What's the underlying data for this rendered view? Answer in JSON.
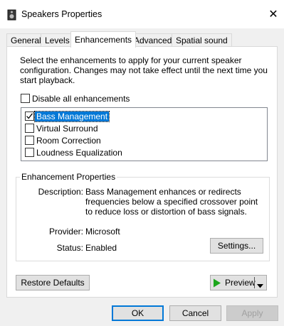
{
  "window": {
    "title": "Speakers Properties",
    "close_icon": "close-icon"
  },
  "tabs": [
    {
      "label": "General",
      "active": false
    },
    {
      "label": "Levels",
      "active": false
    },
    {
      "label": "Enhancements",
      "active": true
    },
    {
      "label": "Advanced",
      "active": false
    },
    {
      "label": "Spatial sound",
      "active": false
    }
  ],
  "enhancements": {
    "instructions": "Select the enhancements to apply for your current speaker configuration. Changes may not take effect until the next time you start playback.",
    "disable_all_label": "Disable all enhancements",
    "disable_all_checked": false,
    "items": [
      {
        "label": "Bass Management",
        "checked": true,
        "selected": true
      },
      {
        "label": "Virtual Surround",
        "checked": false,
        "selected": false
      },
      {
        "label": "Room Correction",
        "checked": false,
        "selected": false
      },
      {
        "label": "Loudness Equalization",
        "checked": false,
        "selected": false
      }
    ]
  },
  "properties": {
    "legend": "Enhancement Properties",
    "description_label": "Description:",
    "description_value": "Bass Management enhances or redirects frequencies below a specified crossover point to reduce loss or distortion of bass signals.",
    "provider_label": "Provider:",
    "provider_value": "Microsoft",
    "status_label": "Status:",
    "status_value": "Enabled",
    "settings_button": "Settings..."
  },
  "actions": {
    "restore_defaults": "Restore Defaults",
    "preview": "Preview",
    "ok": "OK",
    "cancel": "Cancel",
    "apply": "Apply"
  },
  "colors": {
    "selection": "#0078d7",
    "play_icon": "#1ca61c"
  }
}
